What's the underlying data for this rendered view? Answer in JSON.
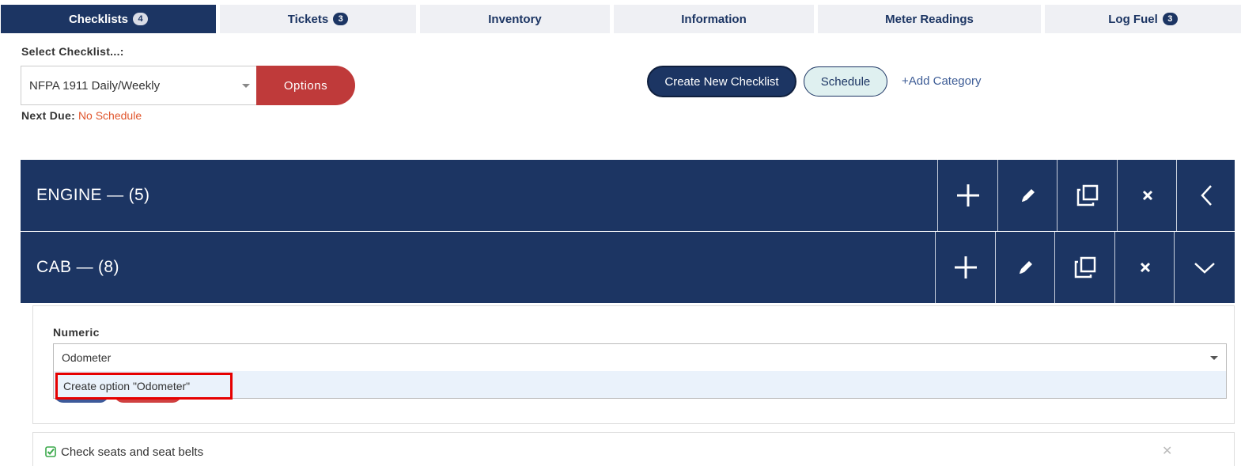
{
  "tabs": [
    {
      "label": "Checklists",
      "badge": "4",
      "active": true
    },
    {
      "label": "Tickets",
      "badge": "3",
      "active": false
    },
    {
      "label": "Inventory",
      "badge": "",
      "active": false
    },
    {
      "label": "Information",
      "badge": "",
      "active": false
    },
    {
      "label": "Meter Readings",
      "badge": "",
      "active": false
    },
    {
      "label": "Log Fuel",
      "badge": "3",
      "active": false
    }
  ],
  "select_checklist": {
    "label": "Select Checklist...:",
    "value": "NFPA 1911 Daily/Weekly",
    "options_label": "Options"
  },
  "next_due": {
    "label": "Next Due:",
    "value": "No Schedule"
  },
  "toolbar": {
    "create_label": "Create New Checklist",
    "schedule_label": "Schedule",
    "add_category_label": "+Add Category"
  },
  "categories": [
    {
      "name": "ENGINE —",
      "count": "(5)",
      "toggle_icon": "chevron-left-icon"
    },
    {
      "name": "CAB —",
      "count": "(8)",
      "toggle_icon": "chevron-down-icon"
    }
  ],
  "category_actions": [
    "plus-icon",
    "pencil-icon",
    "copy-icon",
    "close-icon"
  ],
  "editor": {
    "field_label": "Numeric",
    "input_value": "Odometer",
    "dropdown_option": "Create option \"Odometer\""
  },
  "items": [
    {
      "text": "Check seats and seat belts",
      "checked": true
    }
  ],
  "colors": {
    "primary": "#1c3563",
    "danger": "#bf3a3a",
    "accent_link": "#3e5d96",
    "due_text": "#e0552c",
    "highlight_box": "#e60000"
  }
}
